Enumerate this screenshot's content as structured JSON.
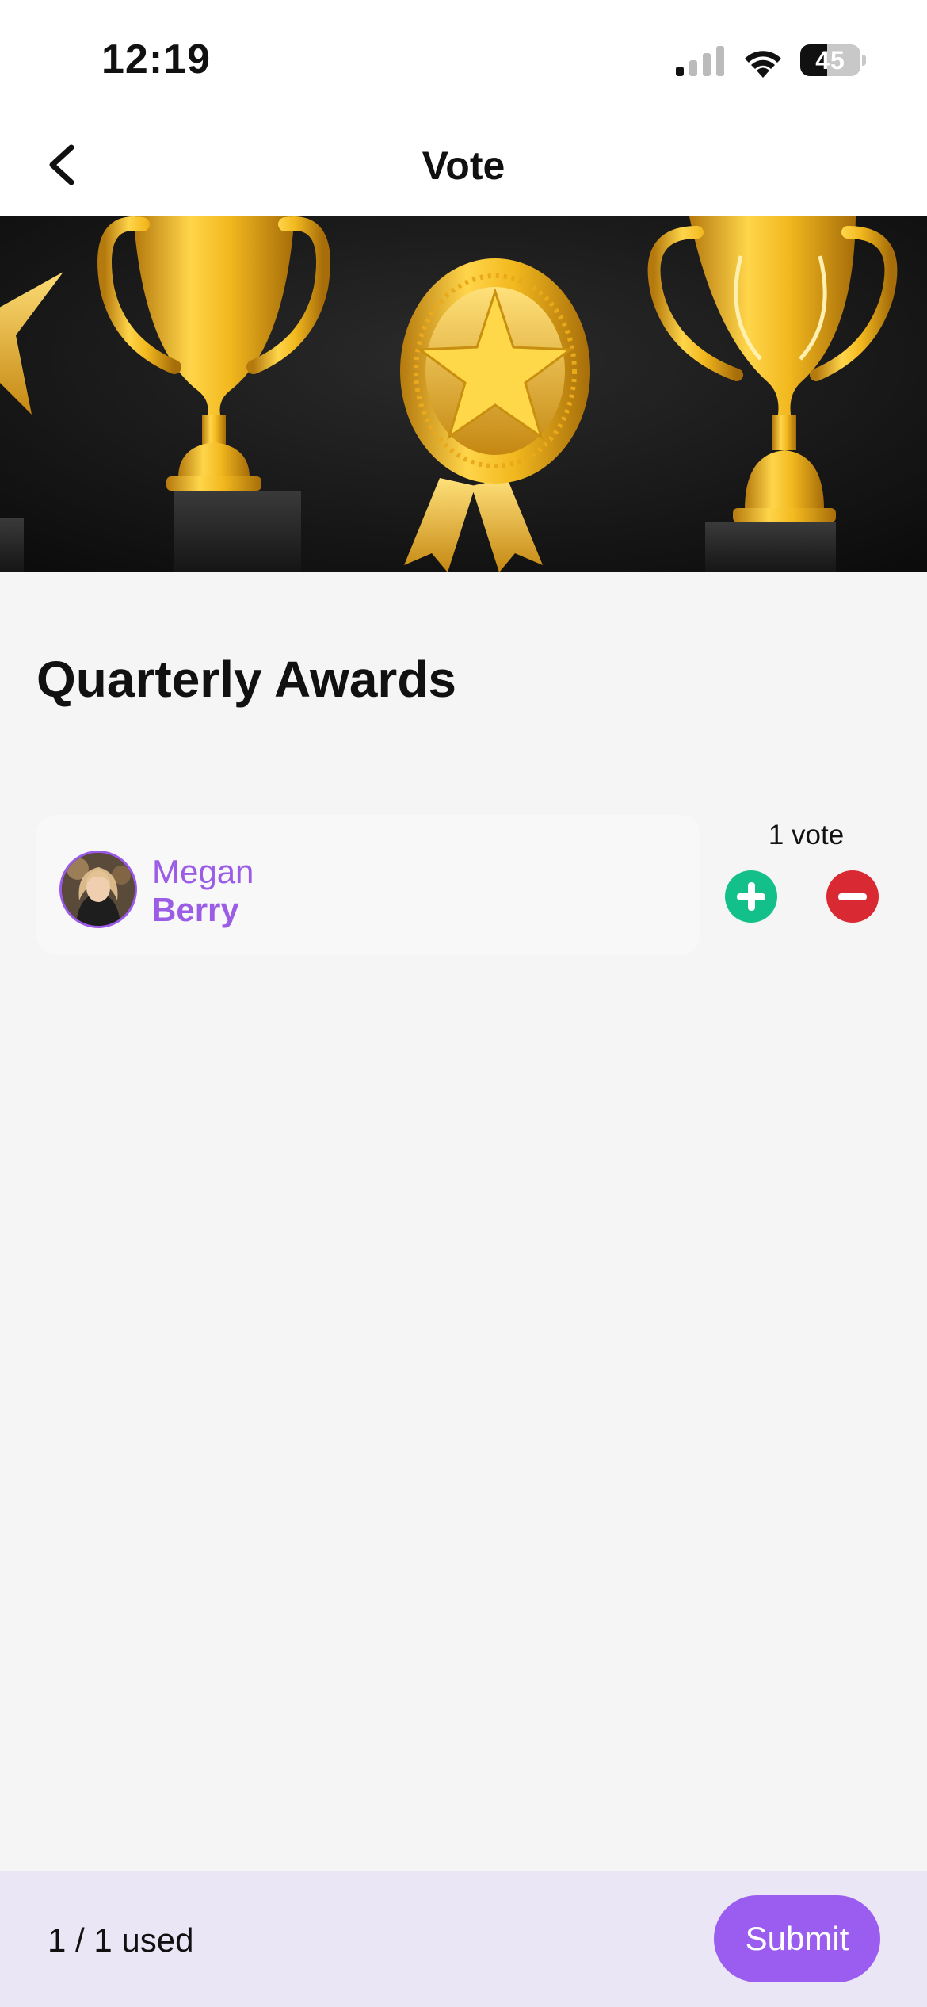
{
  "status_bar": {
    "time": "12:19",
    "battery_level": "45",
    "battery_fraction": 0.45,
    "icons": [
      "cellular-signal-icon",
      "wifi-icon",
      "battery-icon"
    ]
  },
  "nav": {
    "title": "Vote",
    "back_icon": "chevron-left-icon"
  },
  "hero": {
    "image": "trophies-and-medal-banner"
  },
  "page": {
    "title": "Quarterly Awards"
  },
  "candidates": [
    {
      "first_name": "Megan",
      "last_name": "Berry",
      "votes_label": "1 vote",
      "avatar": "profile-photo"
    }
  ],
  "footer": {
    "used_label": "1 / 1 used",
    "submit_label": "Submit"
  },
  "colors": {
    "accent": "#9b5cf0",
    "plus": "#14c08a",
    "minus": "#d92a34",
    "footer_bg": "#ebe6f6"
  }
}
